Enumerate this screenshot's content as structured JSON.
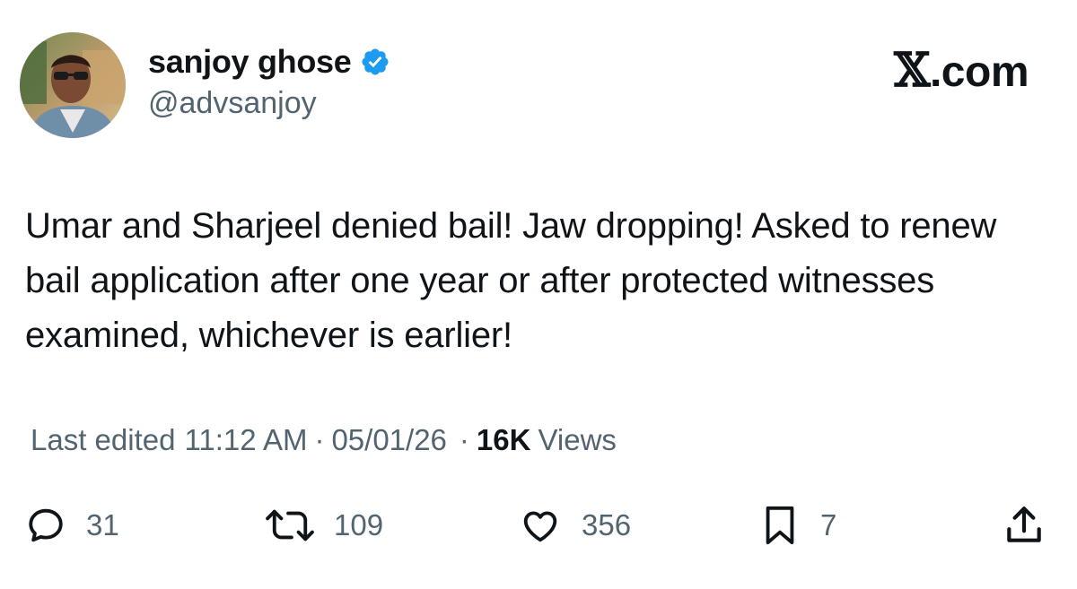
{
  "user": {
    "display_name": "sanjoy ghose",
    "handle": "@advsanjoy",
    "verified": true
  },
  "brand": {
    "x_glyph": "𝕏",
    "suffix": ".com"
  },
  "tweet": {
    "text": "Umar and Sharjeel denied bail! Jaw dropping! Asked to renew bail application after one year or after protected witnesses examined, whichever is earlier!"
  },
  "meta": {
    "edited_prefix": "Last edited",
    "time": "11:12 AM",
    "separator": "·",
    "date": "05/01/26",
    "views_count": "16K",
    "views_label": "Views"
  },
  "actions": {
    "replies": "31",
    "reposts": "109",
    "likes": "356",
    "bookmarks": "7"
  },
  "icons": {
    "reply": "reply-icon",
    "repost": "repost-icon",
    "like": "heart-icon",
    "bookmark": "bookmark-icon",
    "share": "share-icon",
    "verified": "verified-badge-icon"
  },
  "colors": {
    "text_primary": "#0f1419",
    "text_secondary": "#536471",
    "verified_blue": "#1d9bf0"
  }
}
